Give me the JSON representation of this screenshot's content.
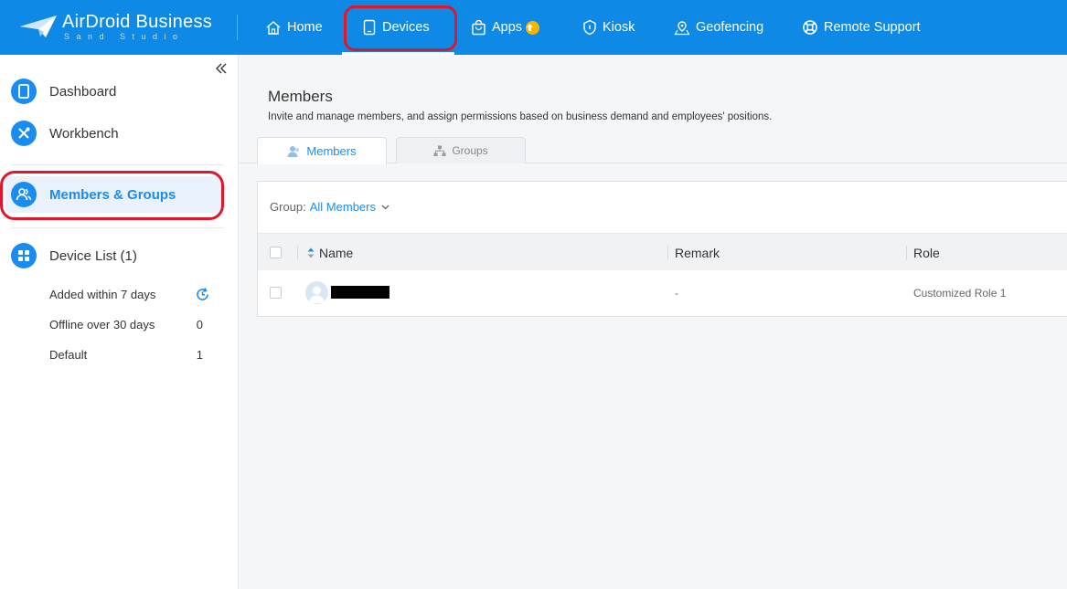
{
  "brand": {
    "title": "AirDroid Business",
    "subtitle": "Sand Studio"
  },
  "nav": {
    "home": "Home",
    "devices": "Devices",
    "apps": "Apps",
    "kiosk": "Kiosk",
    "geofencing": "Geofencing",
    "remote_support": "Remote Support"
  },
  "sidebar": {
    "items": [
      {
        "label": "Dashboard",
        "icon": "tablet-icon"
      },
      {
        "label": "Workbench",
        "icon": "tools-icon"
      },
      {
        "label": "Members & Groups",
        "icon": "users-icon"
      },
      {
        "label": "Device List (1)",
        "icon": "grid-icon"
      }
    ],
    "sub_items": [
      {
        "label": "Added within 7 days",
        "count": ""
      },
      {
        "label": "Offline over 30 days",
        "count": "0"
      },
      {
        "label": "Default",
        "count": "1"
      }
    ]
  },
  "main": {
    "title": "Members",
    "description": "Invite and manage members, and assign permissions based on business demand and employees' positions.",
    "tabs": [
      "Members",
      "Groups"
    ],
    "group_label": "Group:",
    "group_value": "All Members",
    "columns": [
      "Name",
      "Remark",
      "Role"
    ],
    "rows": [
      {
        "name": "",
        "remark": "-",
        "role": "Customized Role 1"
      }
    ]
  },
  "colors": {
    "topbar": "#0f89e6",
    "accent": "#1a8cf0",
    "highlight": "#e0162b"
  }
}
